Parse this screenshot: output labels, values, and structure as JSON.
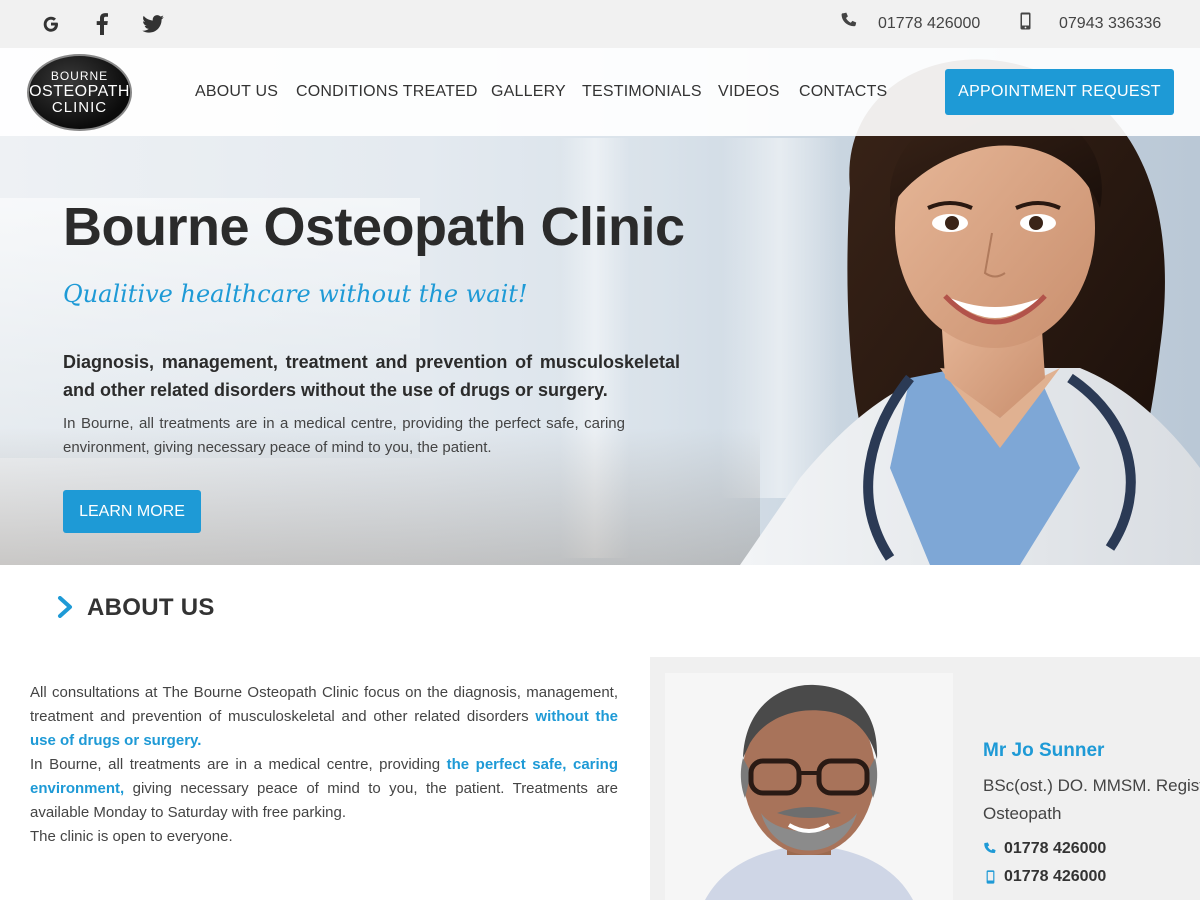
{
  "topbar": {
    "social": [
      {
        "icon": "google-icon"
      },
      {
        "icon": "facebook-icon"
      },
      {
        "icon": "twitter-icon"
      }
    ],
    "phone": "01778 426000",
    "mobile": "07943 336336"
  },
  "logo": {
    "line1": "BOURNE",
    "line2": "OSTEOPATH",
    "line3": "CLINIC"
  },
  "nav": {
    "items": [
      "ABOUT US",
      "CONDITIONS TREATED",
      "GALLERY",
      "TESTIMONIALS",
      "VIDEOS",
      "CONTACTS"
    ],
    "appointment_label": "APPOINTMENT REQUEST"
  },
  "hero": {
    "title": "Bourne Osteopath Clinic",
    "tagline": "Qualitive healthcare without the wait!",
    "lead": "Diagnosis, management, treatment and prevention of musculoskeletal and other related disorders without the use of drugs or surgery.",
    "body": "In Bourne, all treatments are in a medical centre, providing the perfect safe, caring environment, giving necessary peace of mind to you, the patient.",
    "learn_more_label": "LEARN MORE"
  },
  "about": {
    "heading": "ABOUT US",
    "p1_a": "All consultations at The Bourne Osteopath Clinic focus on the diagnosis, management, treatment and prevention of musculoskeletal and other related disorders ",
    "p1_hl": "without the use of drugs or surgery.",
    "p2_a": "In Bourne, all treatments are in a medical centre, providing ",
    "p2_hl": "the perfect safe, caring environment,",
    "p2_b": " giving necessary peace of mind to you, the patient. Treatments are available Monday to Saturday with free parking.",
    "p3": "The clinic is open to everyone."
  },
  "profile": {
    "name": "Mr Jo Sunner",
    "credentials_line1": "BSc(ost.) DO. MMSM. Registered",
    "credentials_line2": "Osteopath",
    "phone": "01778 426000",
    "mobile": "01778 426000"
  },
  "colors": {
    "accent": "#1e9ad6",
    "topbar": "#f1f1f1",
    "text": "#2b2b2b"
  }
}
